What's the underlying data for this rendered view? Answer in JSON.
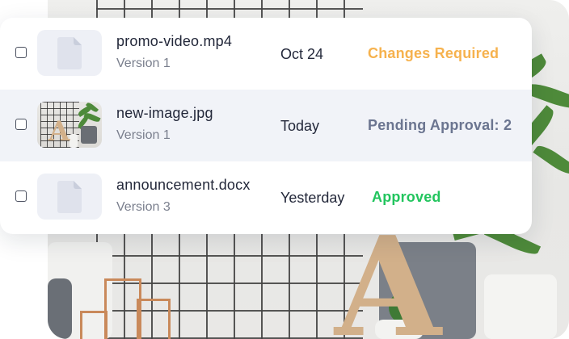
{
  "colors": {
    "status_changes": "#f6b24e",
    "status_pending": "#6b7590",
    "status_approved": "#22c55e"
  },
  "files": [
    {
      "name": "promo-video.mp4",
      "version": "Version 1",
      "date": "Oct 24",
      "status": "Changes Required",
      "thumbnail": "file-icon"
    },
    {
      "name": "new-image.jpg",
      "version": "Version 1",
      "date": "Today",
      "status": "Pending Approval: 2",
      "thumbnail": "image-thumbnail"
    },
    {
      "name": "announcement.docx",
      "version": "Version 3",
      "date": "Yesterday",
      "status": "Approved",
      "thumbnail": "file-icon"
    }
  ]
}
